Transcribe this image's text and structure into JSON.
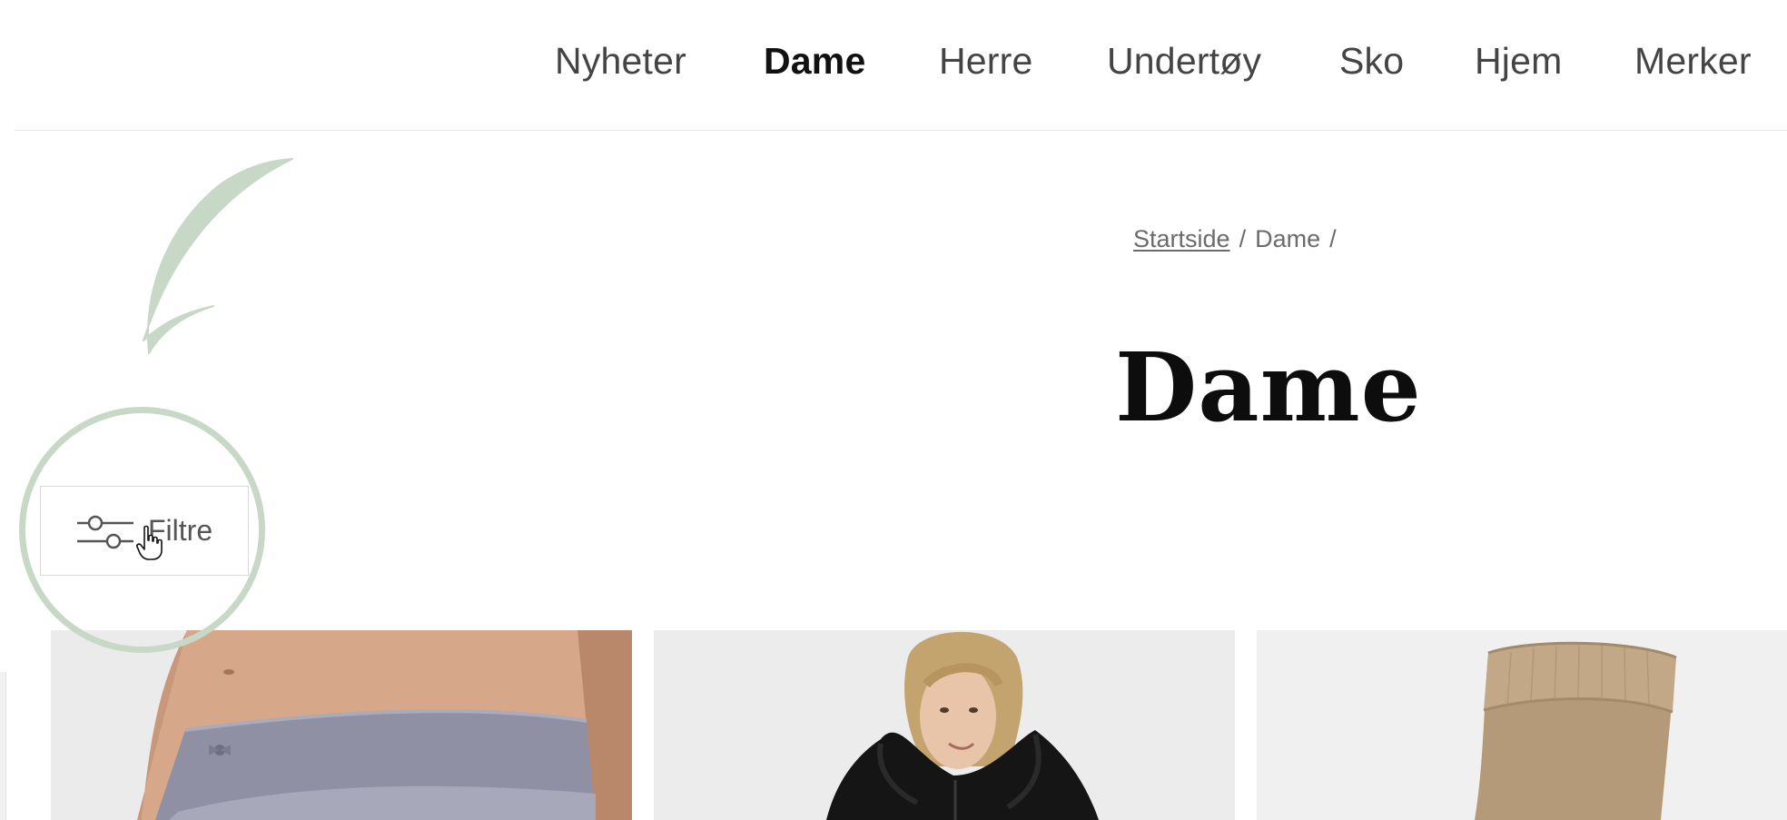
{
  "nav": {
    "items": [
      {
        "label": "Nyheter",
        "active": false
      },
      {
        "label": "Dame",
        "active": true
      },
      {
        "label": "Herre",
        "active": false
      },
      {
        "label": "Undertøy",
        "active": false
      },
      {
        "label": "Sko",
        "active": false
      },
      {
        "label": "Hjem",
        "active": false
      },
      {
        "label": "Merker",
        "active": false
      }
    ]
  },
  "breadcrumb": {
    "home": "Startside",
    "separator": "/",
    "current": "Dame"
  },
  "page": {
    "title": "Dame"
  },
  "filter": {
    "label": "Filtre",
    "icon": "sliders-icon"
  },
  "annotation": {
    "color": "#c7d9c6",
    "shapes": [
      "curved-arrow",
      "circle-highlight"
    ]
  },
  "products": [
    {
      "name": "product-card-lingerie",
      "background": "#ebebeb"
    },
    {
      "name": "product-card-fleece-jacket",
      "background": "#ececec"
    },
    {
      "name": "product-card-socks",
      "background": "#f0f0f0"
    }
  ],
  "colors": {
    "text": "#444444",
    "active_text": "#111111",
    "divider": "#e6e6e6",
    "accent_annotation": "#c7d9c6"
  }
}
